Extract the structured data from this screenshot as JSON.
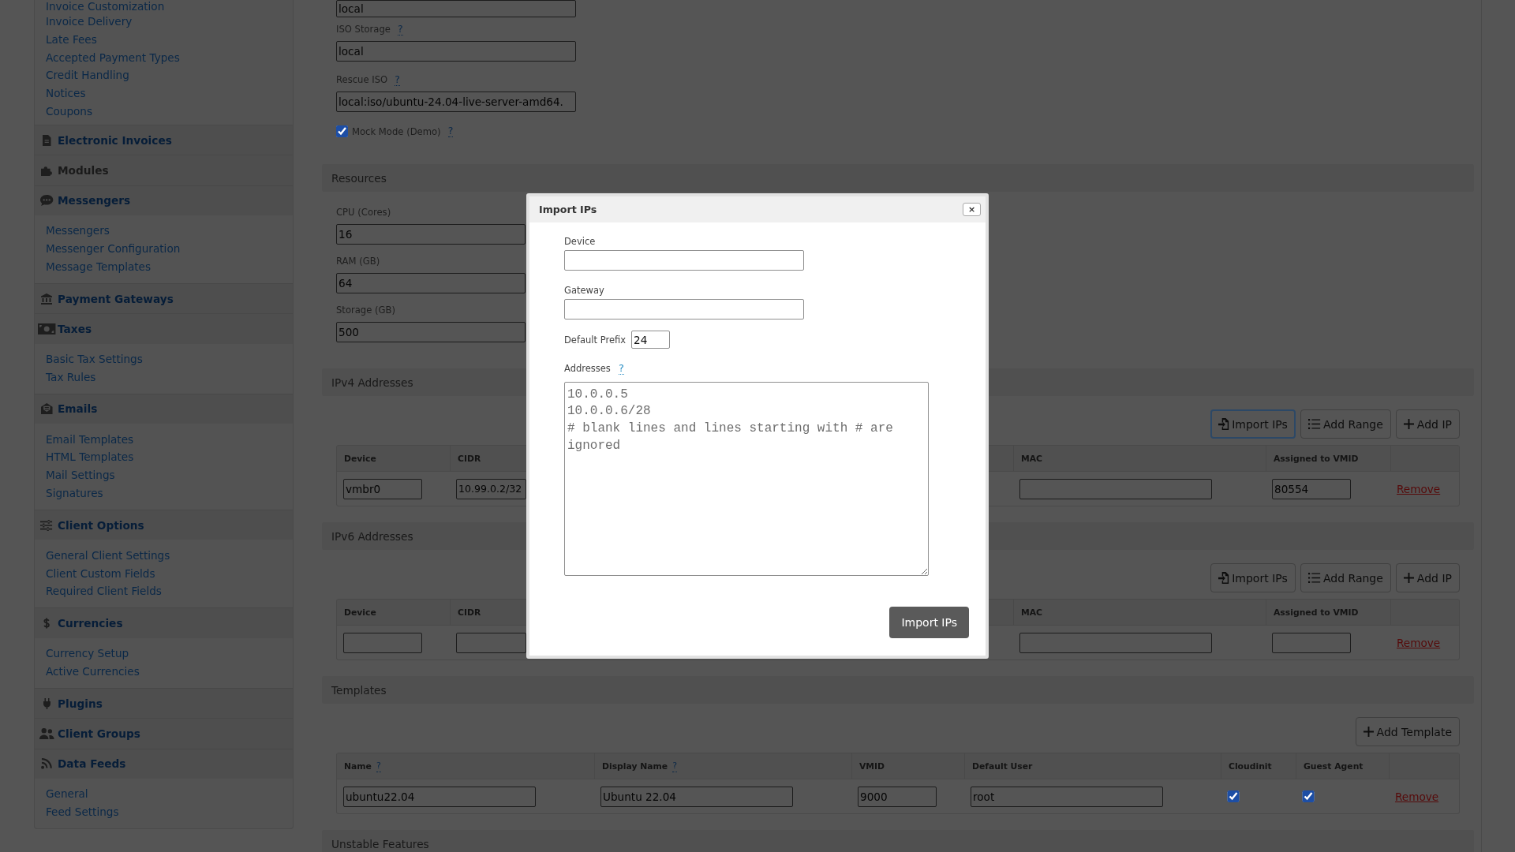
{
  "sidebar": {
    "groups": [
      {
        "items": [
          "Invoice Customization",
          "Invoice Delivery",
          "Late Fees",
          "Accepted Payment Types",
          "Credit Handling",
          "Notices",
          "Coupons"
        ]
      },
      {
        "title": "Electronic Invoices",
        "selected": false
      },
      {
        "title": "Modules",
        "selected": true
      },
      {
        "title": "Messengers",
        "selected": false,
        "items": [
          "Messengers",
          "Messenger Configuration",
          "Message Templates"
        ]
      },
      {
        "title": "Payment Gateways",
        "selected": false
      },
      {
        "title": "Taxes",
        "selected": false,
        "items": [
          "Basic Tax Settings",
          "Tax Rules"
        ]
      },
      {
        "title": "Emails",
        "selected": false,
        "items": [
          "Email Templates",
          "HTML Templates",
          "Mail Settings",
          "Signatures"
        ]
      },
      {
        "title": "Client Options",
        "selected": false,
        "items": [
          "General Client Settings",
          "Client Custom Fields",
          "Required Client Fields"
        ]
      },
      {
        "title": "Currencies",
        "selected": false,
        "items": [
          "Currency Setup",
          "Active Currencies"
        ]
      },
      {
        "title": "Plugins",
        "selected": false
      },
      {
        "title": "Client Groups",
        "selected": false
      },
      {
        "title": "Data Feeds",
        "selected": false,
        "items": [
          "General",
          "Feed Settings"
        ]
      }
    ]
  },
  "main": {
    "sections": [
      {
        "fields": [
          {
            "value": "local"
          },
          {
            "label": "ISO Storage",
            "help": "?",
            "value": "local"
          },
          {
            "label": "Rescue ISO",
            "help": "?",
            "value": "local:iso/ubuntu-24.04-live-server-amd64."
          }
        ],
        "checkbox": {
          "label": "Mock Mode (Demo)",
          "help": "?",
          "checked": true
        }
      },
      {
        "title": "Resources",
        "fields": [
          {
            "label": "CPU (Cores)",
            "value": "16"
          },
          {
            "label": "RAM (GB)",
            "value": "64"
          },
          {
            "label": "Storage (GB)",
            "value": "500"
          }
        ]
      },
      {
        "title": "IPv4 Addresses",
        "buttons": [
          {
            "kind": "import",
            "label": "Import IPs",
            "focused": true
          },
          {
            "kind": "range",
            "label": "Add Range",
            "focused": false
          },
          {
            "kind": "add",
            "label": "Add IP",
            "focused": false
          }
        ],
        "table": {
          "kind": "addresses",
          "columns": [
            {
              "label": "Device"
            },
            {
              "label": "CIDR"
            },
            {
              "label": "MAC"
            },
            {
              "label": "Assigned to VMID"
            }
          ],
          "rows": [
            {
              "cells": [
                {
                  "kind": "input",
                  "value": "vmbr0"
                },
                {
                  "kind": "input",
                  "value": "10.99.0.2/32"
                },
                {
                  "kind": "input"
                },
                {
                  "kind": "input",
                  "value": "80554"
                },
                {
                  "kind": "link",
                  "label": "Remove"
                }
              ]
            }
          ]
        }
      },
      {
        "title": "IPv6 Addresses",
        "buttons": [
          {
            "kind": "import",
            "label": "Import IPs",
            "focused": false
          },
          {
            "kind": "range",
            "label": "Add Range",
            "focused": false
          },
          {
            "kind": "add",
            "label": "Add IP",
            "focused": false
          }
        ],
        "table": {
          "kind": "addresses",
          "columns": [
            {
              "label": "Device"
            },
            {
              "label": "CIDR"
            },
            {
              "label": "MAC"
            },
            {
              "label": "Assigned to VMID"
            }
          ],
          "rows": [
            {
              "cells": [
                {
                  "kind": "input"
                },
                {
                  "kind": "input"
                },
                {
                  "kind": "input"
                },
                {
                  "kind": "input"
                },
                {
                  "kind": "link",
                  "label": "Remove"
                }
              ]
            }
          ]
        }
      },
      {
        "title": "Templates",
        "buttons": [
          {
            "kind": "add",
            "label": "Add Template",
            "focused": false
          }
        ],
        "table": {
          "kind": "templates",
          "columns": [
            {
              "label": "Name",
              "help": "?"
            },
            {
              "label": "Display Name",
              "help": "?"
            },
            {
              "label": "VMID"
            },
            {
              "label": "Default User"
            },
            {
              "label": "Cloudinit"
            },
            {
              "label": "Guest Agent"
            }
          ],
          "rows": [
            {
              "cells": [
                {
                  "kind": "input",
                  "value": "ubuntu22.04"
                },
                {
                  "kind": "input",
                  "value": "Ubuntu 22.04"
                },
                {
                  "kind": "input",
                  "value": "9000"
                },
                {
                  "kind": "input",
                  "value": "root"
                },
                {
                  "kind": "checkbox",
                  "checked": true
                },
                {
                  "kind": "checkbox",
                  "checked": true
                },
                {
                  "kind": "link",
                  "label": "Remove"
                }
              ]
            }
          ]
        }
      },
      {
        "title": "Unstable Features"
      }
    ]
  },
  "dialog": {
    "title": "Import IPs",
    "close": "×",
    "fields": [
      {
        "kind": "text",
        "label": "Device"
      },
      {
        "kind": "text",
        "label": "Gateway"
      },
      {
        "kind": "inline",
        "label": "Default Prefix",
        "value": "24"
      },
      {
        "kind": "textarea",
        "label": "Addresses",
        "help": "?",
        "placeholder": "10.0.0.5\n10.0.0.6/28\n# blank lines and lines starting with # are ignored"
      }
    ],
    "submit": "Import IPs"
  }
}
